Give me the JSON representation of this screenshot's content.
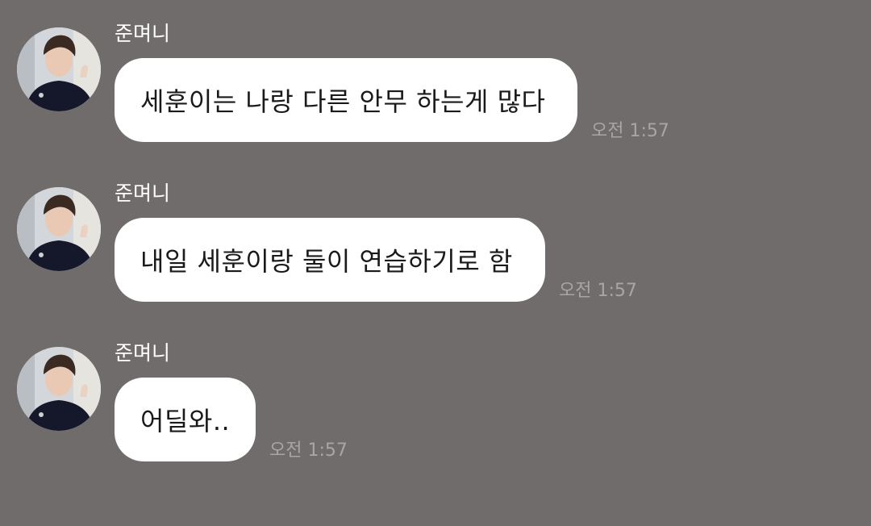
{
  "messages": [
    {
      "sender": "준며니",
      "text": "세훈이는 나랑 다른 안무 하는게 많다",
      "time": "오전 1:57"
    },
    {
      "sender": "준며니",
      "text": "내일 세훈이랑 둘이 연습하기로 함",
      "time": "오전 1:57"
    },
    {
      "sender": "준며니",
      "text": "어딜와..",
      "time": "오전 1:57"
    }
  ],
  "colors": {
    "background": "#706c6b",
    "bubble": "#ffffff",
    "sender_text": "#ffffff",
    "message_text": "#1a1a1a",
    "time_text": "#a9a5a4"
  },
  "icons": {
    "avatar": "profile-photo"
  }
}
